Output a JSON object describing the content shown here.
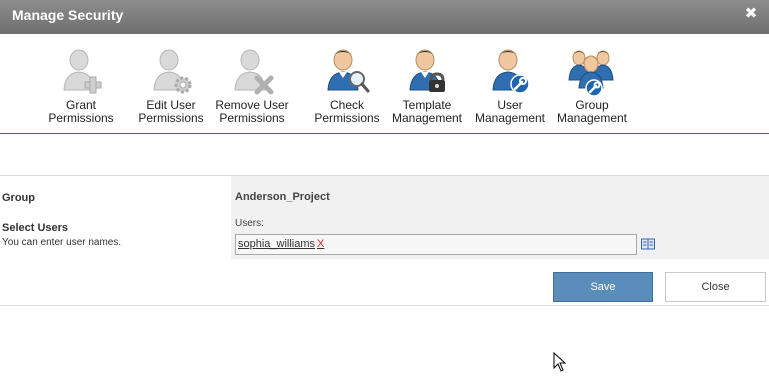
{
  "dialog": {
    "title": "Manage Security",
    "close_icon": "close-icon"
  },
  "toolbar": {
    "buttons": [
      {
        "label": "Grant\nPermissions",
        "icon": "grant-permissions-icon"
      },
      {
        "label": "Edit User\nPermissions",
        "icon": "edit-user-permissions-icon"
      },
      {
        "label": "Remove User\nPermissions",
        "icon": "remove-user-permissions-icon"
      },
      {
        "label": "Check\nPermissions",
        "icon": "check-permissions-icon"
      },
      {
        "label": "Template\nManagement",
        "icon": "template-management-icon"
      },
      {
        "label": "User\nManagement",
        "icon": "user-management-icon"
      },
      {
        "label": "Group\nManagement",
        "icon": "group-management-icon"
      }
    ]
  },
  "form": {
    "group_label": "Group",
    "group_value": "Anderson_Project",
    "select_users_label": "Select Users",
    "select_users_hint": "You can enter user names.",
    "users_label": "Users:",
    "users": [
      {
        "name": "sophia_williams",
        "remove": "X"
      }
    ]
  },
  "actions": {
    "save_label": "Save",
    "close_label": "Close"
  },
  "colors": {
    "titlebar": "#7d7d7d",
    "accent_line": "#c0392b",
    "save_button": "#5b8dba"
  }
}
